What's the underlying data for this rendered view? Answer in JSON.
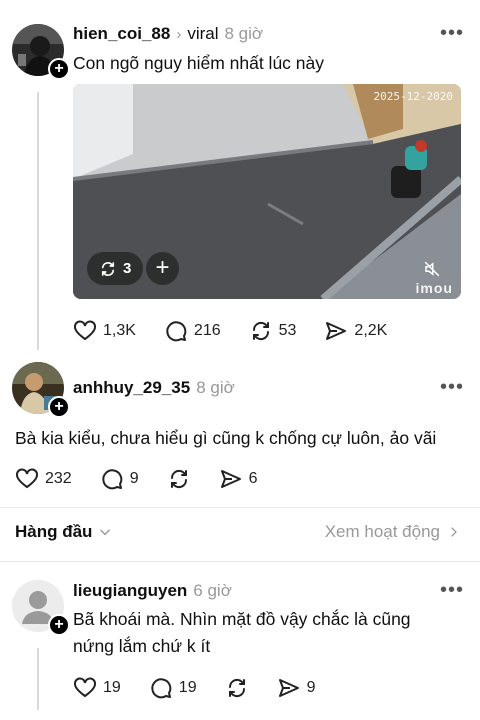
{
  "post1": {
    "username": "hien_coi_88",
    "topic": "viral",
    "time": "8 giờ",
    "text": "Con ngõ nguy hiểm nhất lúc này",
    "media": {
      "repost_count": "3",
      "timestamp_overlay": "2025-12-2020",
      "watermark": "imou"
    },
    "likes": "1,3K",
    "replies": "216",
    "reposts": "53",
    "shares": "2,2K"
  },
  "post2": {
    "username": "anhhuy_29_35",
    "time": "8 giờ",
    "text": "Bà kia kiểu, chưa hiểu gì cũng k chống cự luôn, ảo vãi",
    "likes": "232",
    "replies": "9",
    "shares": "6"
  },
  "sort": {
    "label": "Hàng đầu",
    "activity": "Xem hoạt động"
  },
  "post3": {
    "username": "lieugianguyen",
    "time": "6 giờ",
    "text_line1": "Bã khoái mà. Nhìn mặt đồ vậy chắc là cũng",
    "text_line2": "nứng lắm chứ k ít",
    "likes": "19",
    "replies": "19",
    "shares": "9"
  }
}
